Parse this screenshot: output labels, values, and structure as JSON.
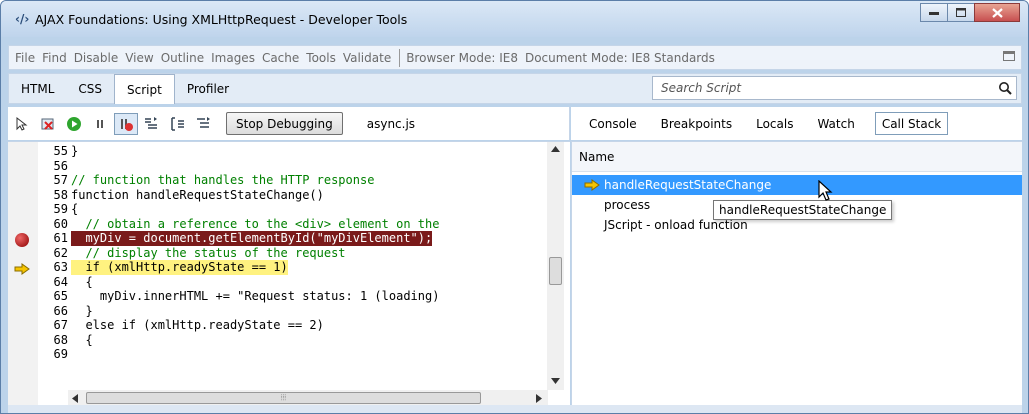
{
  "window": {
    "title": "AJAX Foundations: Using XMLHttpRequest - Developer Tools",
    "logo": "‹/›",
    "controls": [
      "minimize",
      "maximize",
      "close"
    ]
  },
  "menu": {
    "items": [
      "File",
      "Find",
      "Disable",
      "View",
      "Outline",
      "Images",
      "Cache",
      "Tools",
      "Validate"
    ],
    "browser_mode": "Browser Mode: IE8",
    "document_mode": "Document Mode: IE8 Standards"
  },
  "tabs": [
    "HTML",
    "CSS",
    "Script",
    "Profiler"
  ],
  "active_tab": "Script",
  "search": {
    "placeholder": "Search Script"
  },
  "toolbar": {
    "stop_label": "Stop Debugging",
    "file": "async.js"
  },
  "right_tabs": [
    "Console",
    "Breakpoints",
    "Locals",
    "Watch",
    "Call Stack"
  ],
  "active_right_tab": "Call Stack",
  "code": {
    "lines": [
      {
        "n": "55",
        "text": "}"
      },
      {
        "n": "56",
        "text": ""
      },
      {
        "n": "57",
        "text": "// function that handles the HTTP response"
      },
      {
        "n": "58",
        "text": "function handleRequestStateChange()"
      },
      {
        "n": "59",
        "text": "{"
      },
      {
        "n": "60",
        "text": "  // obtain a reference to the <div> element on the"
      },
      {
        "n": "61",
        "text": "  myDiv = document.getElementById(\"myDivElement\");"
      },
      {
        "n": "62",
        "text": "  // display the status of the request"
      },
      {
        "n": "63",
        "text": "  if (xmlHttp.readyState == 1)"
      },
      {
        "n": "64",
        "text": "  {"
      },
      {
        "n": "65",
        "text": "    myDiv.innerHTML += \"Request status: 1 (loading)"
      },
      {
        "n": "66",
        "text": "  }"
      },
      {
        "n": "67",
        "text": "  else if (xmlHttp.readyState == 2)"
      },
      {
        "n": "68",
        "text": "  {"
      },
      {
        "n": "69",
        "text": ""
      }
    ],
    "breakpoint_line": "61",
    "current_line": "63"
  },
  "call_stack": {
    "header": "Name",
    "items": [
      "handleRequestStateChange",
      "process",
      "JScript - onload function"
    ],
    "tooltip": "handleRequestStateChange"
  },
  "colors": {
    "keyword": "#0000ff",
    "comment": "#008000",
    "string": "#a31515",
    "breakpoint_bg": "#7a1a1a",
    "current_bg": "#fff280",
    "selection": "#3399ff"
  }
}
